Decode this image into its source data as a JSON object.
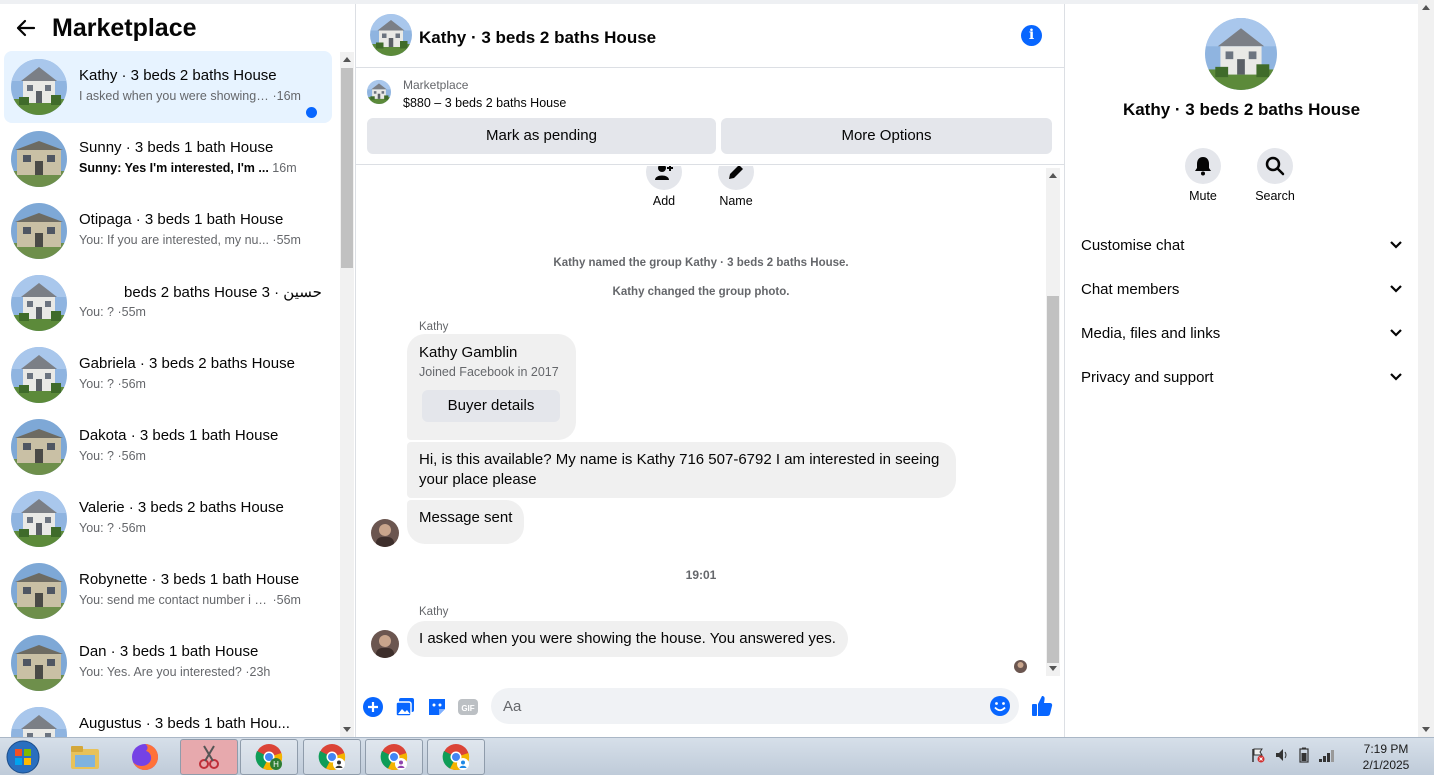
{
  "left": {
    "title": "Marketplace",
    "conversations": [
      {
        "name": "Kathy · 3 beds 2 baths House",
        "snippet": "I asked when you were showing t...",
        "time": "·16m",
        "active": true,
        "unread": false
      },
      {
        "name": "Sunny · 3 beds 1 bath House",
        "snippet": "Sunny: Yes I'm interested, I'm ...",
        "time": "16m",
        "active": false,
        "unread": true
      },
      {
        "name": "Otipaga · 3 beds 1 bath House",
        "snippet": "You: If you are interested, my nu...",
        "time": "·55m",
        "active": false,
        "unread": false
      },
      {
        "name": "حسين · 3 beds 2 baths House",
        "snippet": "You: ?",
        "time": "·55m",
        "active": false,
        "unread": false
      },
      {
        "name": "Gabriela · 3 beds 2 baths House",
        "snippet": "You: ?",
        "time": "·56m",
        "active": false,
        "unread": false
      },
      {
        "name": "Dakota · 3 beds 1 bath House",
        "snippet": "You: ?",
        "time": "·56m",
        "active": false,
        "unread": false
      },
      {
        "name": "Valerie · 3 beds 2 baths House",
        "snippet": "You: ?",
        "time": "·56m",
        "active": false,
        "unread": false
      },
      {
        "name": "Robynette · 3 beds 1 bath House",
        "snippet": "You: send me contact number i w...",
        "time": "·56m",
        "active": false,
        "unread": false
      },
      {
        "name": "Dan · 3 beds 1 bath House",
        "snippet": "You: Yes. Are you interested?",
        "time": "·23h",
        "active": false,
        "unread": false
      },
      {
        "name": "Augustus · 3 beds 1 bath Hou...",
        "snippet": "",
        "time": "",
        "active": false,
        "unread": false
      }
    ]
  },
  "chat": {
    "title": "Kathy · 3 beds 2 baths House",
    "listing_source": "Marketplace",
    "listing_price": "$880 – 3 beds 2 baths House",
    "mark_pending": "Mark as pending",
    "more_options": "More Options",
    "actions": {
      "add": "Add",
      "name": "Name"
    },
    "system_1": "Kathy named the group Kathy · 3 beds 2 baths House.",
    "system_2": "Kathy changed the group photo.",
    "sender_1": "Kathy",
    "card_name": "Kathy Gamblin",
    "card_joined": "Joined Facebook in 2017",
    "card_button": "Buyer details",
    "message_1": "Hi, is this available? My name is Kathy 716 507-6792 I am interested in seeing your place please",
    "message_2": "Message sent",
    "timestamp": "19:01",
    "sender_2": "Kathy",
    "message_3": "I asked when you were showing the house. You answered yes.",
    "composer_placeholder": "Aa"
  },
  "right": {
    "title": "Kathy · 3 beds 2 baths House",
    "mute": "Mute",
    "search": "Search",
    "sections": [
      "Customise chat",
      "Chat members",
      "Media, files and links",
      "Privacy and support"
    ]
  },
  "taskbar": {
    "time": "7:19 PM",
    "date": "2/1/2025"
  },
  "colors": {
    "accent": "#0866ff",
    "active_bg": "#e7f3ff",
    "bubble": "#f0f0f0"
  }
}
